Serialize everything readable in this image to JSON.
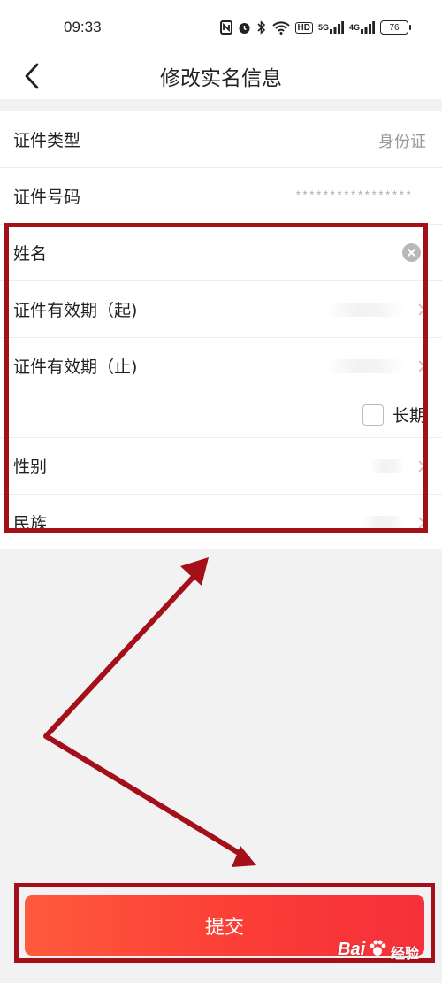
{
  "status_bar": {
    "time": "09:33",
    "network_5g": "5G",
    "network_4g": "4G",
    "hd_label": "HD",
    "battery_level": "76"
  },
  "header": {
    "title": "修改实名信息",
    "back_icon": "chevron-left-icon"
  },
  "form": {
    "id_type": {
      "label": "证件类型",
      "value": "身份证"
    },
    "id_number": {
      "label": "证件号码",
      "value": "*****************"
    },
    "name": {
      "label": "姓名",
      "clear_icon": "clear-circle-icon"
    },
    "valid_from": {
      "label": "证件有效期（起)"
    },
    "valid_to": {
      "label": "证件有效期（止)"
    },
    "long_term": {
      "label": "长期",
      "checked": false
    },
    "gender": {
      "label": "性别"
    },
    "ethnicity": {
      "label": "民族"
    }
  },
  "actions": {
    "submit_label": "提交"
  },
  "annotations": {
    "highlight_color": "#a3101a",
    "accent_gradient": [
      "#ff5a3c",
      "#f5303a"
    ]
  },
  "watermark": {
    "brand": "Bai",
    "brand_cn": "经验",
    "url": "jingyan.baidu.com"
  }
}
